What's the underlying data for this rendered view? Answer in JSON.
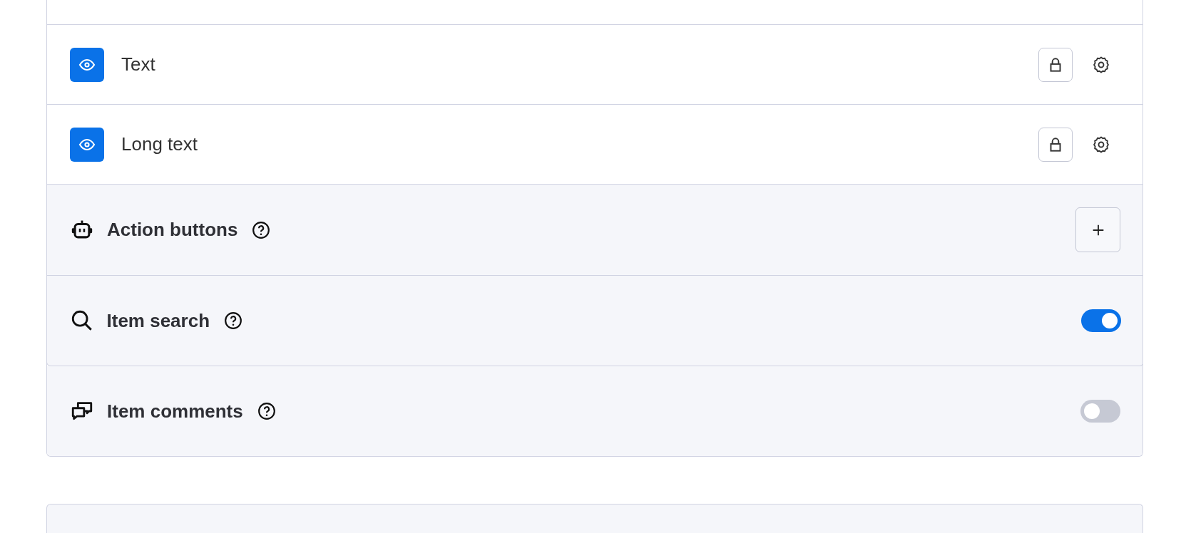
{
  "fields": [
    {
      "label": "Text",
      "visible": true
    },
    {
      "label": "Long text",
      "visible": true
    }
  ],
  "sections": [
    {
      "kind": "add",
      "title": "Action buttons"
    },
    {
      "kind": "toggle",
      "title": "Item search",
      "on": true
    }
  ],
  "extra_sections": [
    {
      "kind": "toggle",
      "title": "Item comments",
      "on": false
    }
  ]
}
